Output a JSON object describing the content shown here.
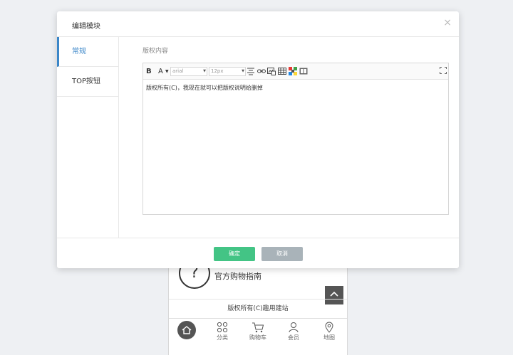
{
  "modal": {
    "title": "编辑模块",
    "close_glyph": "×",
    "side_tabs": [
      {
        "label": "常规",
        "active": true
      },
      {
        "label": "TOP按钮",
        "active": false
      }
    ],
    "field_label": "版权内容",
    "editor": {
      "toolbar": {
        "bold": "B",
        "font_color": "A",
        "font_family": "arial",
        "font_size": "12px"
      },
      "content": "版权所有(C)，我现在就可以把版权说明给删掉"
    },
    "confirm_label": "确定",
    "cancel_label": "取消"
  },
  "preview": {
    "guide_text": "官方购物指南",
    "guide_icon": "?",
    "copyright": "版权所有(C)趣用建站",
    "tabs": [
      {
        "label": "",
        "icon": "home-icon"
      },
      {
        "label": "分类",
        "icon": "grid-icon"
      },
      {
        "label": "购物车",
        "icon": "cart-icon"
      },
      {
        "label": "会员",
        "icon": "user-icon"
      },
      {
        "label": "地图",
        "icon": "map-pin-icon"
      }
    ]
  },
  "colors": {
    "accent": "#3a86c8",
    "confirm": "#43c485",
    "cancel": "#a9b3b9",
    "background": "#eef0f3"
  }
}
